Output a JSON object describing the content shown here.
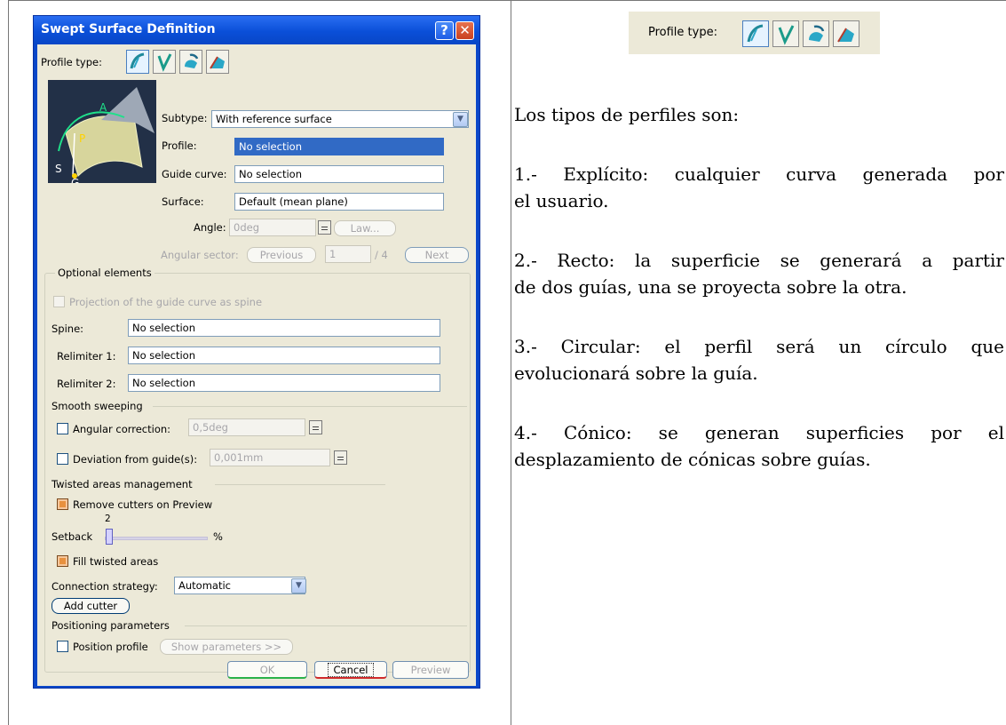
{
  "dialog": {
    "title": "Swept Surface Definition",
    "help_label": "?",
    "close_label": "✕",
    "profile_type_label": "Profile type:",
    "subtype_label": "Subtype:",
    "subtype_value": "With reference surface",
    "profile_label": "Profile:",
    "profile_value": "No selection",
    "guide_curve_label": "Guide curve:",
    "guide_curve_value": "No selection",
    "surface_label": "Surface:",
    "surface_value": "Default (mean plane)",
    "angle_label": "Angle:",
    "angle_value": "0deg",
    "law_button": "Law...",
    "angular_sector_label": "Angular sector:",
    "previous_button": "Previous",
    "sector_value": "1",
    "sector_total": "/ 4",
    "next_button": "Next",
    "diagram_labels": {
      "a": "A",
      "p": "P",
      "s": "S",
      "g": "G"
    },
    "optional": {
      "title": "Optional elements",
      "projection_label": "Projection of the guide curve as spine",
      "spine_label": "Spine:",
      "spine_value": "No selection",
      "relimiter1_label": "Relimiter 1:",
      "relimiter1_value": "No selection",
      "relimiter2_label": "Relimiter 2:",
      "relimiter2_value": "No selection"
    },
    "smooth": {
      "title": "Smooth sweeping",
      "angular_correction_label": "Angular correction:",
      "angular_correction_value": "0,5deg",
      "deviation_label": "Deviation from guide(s):",
      "deviation_value": "0,001mm"
    },
    "twisted": {
      "title": "Twisted areas management",
      "remove_cutters_label": "Remove cutters on Preview",
      "setback_label": "Setback",
      "setback_value": "2",
      "setback_unit": "%",
      "fill_twisted_label": "Fill twisted areas",
      "connection_label": "Connection strategy:",
      "connection_value": "Automatic",
      "add_cutter_button": "Add cutter"
    },
    "positioning": {
      "title": "Positioning parameters",
      "position_profile_label": "Position profile",
      "show_parameters_button": "Show parameters >>"
    },
    "ok_button": "OK",
    "cancel_button": "Cancel",
    "preview_button": "Preview"
  },
  "toolbar": {
    "label": "Profile type:"
  },
  "text": {
    "intro": "Los tipos de perfiles son:",
    "item1_line1": "1.- Explícito: cualquier curva generada por",
    "item1_line2": "el usuario.",
    "item2_line1": "2.- Recto: la superficie se generará a partir",
    "item2_line2": "de dos guías, una se proyecta sobre la otra.",
    "item3_line1": "3.- Circular: el perfil será un círculo que",
    "item3_line2": "evolucionará sobre la guía.",
    "item4_line1": "4.- Cónico: se generan superficies por el",
    "item4_line2": "desplazamiento de cónicas sobre guías."
  },
  "colors": {
    "titlebar": "#0a47c9",
    "dialog_bg": "#ece9d8",
    "selection": "#316ac5",
    "checkbox_checked": "#e8913f"
  }
}
